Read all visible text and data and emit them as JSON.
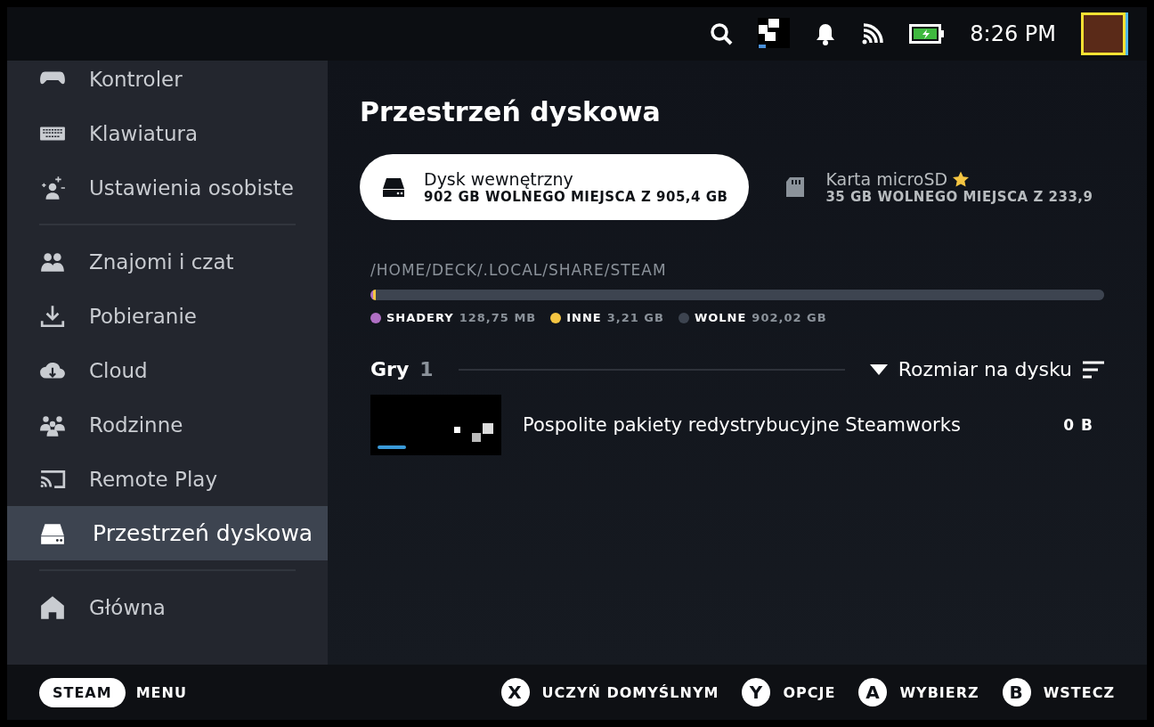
{
  "status_bar": {
    "time": "8:26 PM"
  },
  "sidebar": {
    "sections": [
      [
        {
          "label": "Kontroler",
          "selected": false
        },
        {
          "label": "Klawiatura",
          "selected": false
        },
        {
          "label": "Ustawienia osobiste",
          "selected": false
        }
      ],
      [
        {
          "label": "Znajomi i czat",
          "selected": false
        },
        {
          "label": "Pobieranie",
          "selected": false
        },
        {
          "label": "Cloud",
          "selected": false
        },
        {
          "label": "Rodzinne",
          "selected": false
        },
        {
          "label": "Remote Play",
          "selected": false
        },
        {
          "label": "Przestrzeń dyskowa",
          "selected": true
        }
      ],
      [
        {
          "label": "Główna",
          "selected": false
        }
      ]
    ]
  },
  "page": {
    "title": "Przestrzeń dyskowa",
    "drives": [
      {
        "name": "Dysk wewnętrzny",
        "space": "902 GB WOLNEGO MIEJSCA Z 905,4 GB",
        "selected": true,
        "starred": false
      },
      {
        "name": "Karta microSD",
        "space": "35 GB WOLNEGO MIEJSCA Z 233,9",
        "selected": false,
        "starred": true
      }
    ],
    "path": "/HOME/DECK/.LOCAL/SHARE/STEAM",
    "usage": [
      {
        "label": "SHADERY",
        "value": "128,75 MB",
        "color": "#b06fc4",
        "level": 0.001
      },
      {
        "label": "INNE",
        "value": "3,21 GB",
        "color": "#f5c542",
        "level": 0.004
      },
      {
        "label": "WOLNE",
        "value": "902,02 GB",
        "color": "#3d4450",
        "level": 0.995
      }
    ],
    "games": {
      "label": "Gry",
      "count": "1",
      "sort": "Rozmiar na dysku",
      "rows": [
        {
          "name": "Pospolite pakiety redystrybucyjne Steamworks",
          "size": "0 B"
        }
      ]
    }
  },
  "footer": {
    "steam": "STEAM",
    "menu": "MENU",
    "actions": [
      {
        "button": "X",
        "label": "UCZYŃ DOMYŚLNYM"
      },
      {
        "button": "Y",
        "label": "OPCJE"
      },
      {
        "button": "A",
        "label": "WYBIERZ"
      },
      {
        "button": "B",
        "label": "WSTECZ"
      }
    ]
  }
}
